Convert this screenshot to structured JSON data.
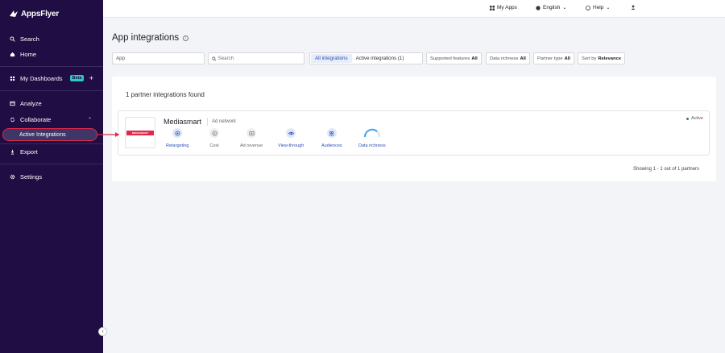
{
  "brand": {
    "name": "AppsFlyer"
  },
  "sidebar": {
    "items": [
      {
        "label": "Search",
        "icon": "search-icon"
      },
      {
        "label": "Home",
        "icon": "home-icon"
      },
      {
        "label": "My Dashboards",
        "icon": "dashboard-icon",
        "badge": "Beta"
      },
      {
        "label": "Analyze",
        "icon": "analyze-icon"
      },
      {
        "label": "Collaborate",
        "icon": "collaborate-icon"
      },
      {
        "label": "Active Integrations"
      },
      {
        "label": "Export",
        "icon": "export-icon"
      },
      {
        "label": "Settings",
        "icon": "gear-icon"
      }
    ]
  },
  "topbar": {
    "my_apps": "My Apps",
    "language": "English",
    "help": "Help"
  },
  "page": {
    "title": "App integrations"
  },
  "filters": {
    "app_value": "App",
    "search_placeholder": "Search",
    "tabs": [
      "All integrations",
      "Active integrations (1)"
    ],
    "supported_features": {
      "label": "Supported features",
      "value": "All"
    },
    "data_richness": {
      "label": "Data richness",
      "value": "All"
    },
    "partner_type": {
      "label": "Partner type",
      "value": "All"
    },
    "sort_by": {
      "label": "Sort by",
      "value": "Relevance"
    }
  },
  "results": {
    "found_text": "1 partner integrations found",
    "showing_text": "Showing 1 - 1 out of 1 partners"
  },
  "partner": {
    "name": "Mediasmart",
    "type": "Ad network",
    "status": "Active",
    "logo_text": "MEDIASMART",
    "features": [
      {
        "label": "Retargeting",
        "enabled": true,
        "icon": "target-icon"
      },
      {
        "label": "Cost",
        "enabled": false,
        "icon": "dollar-icon"
      },
      {
        "label": "Ad revenue",
        "enabled": false,
        "icon": "ad-revenue-icon"
      },
      {
        "label": "View-through",
        "enabled": true,
        "icon": "eye-icon"
      },
      {
        "label": "Audiences",
        "enabled": true,
        "icon": "users-icon"
      },
      {
        "label": "Data richness",
        "enabled": true,
        "icon": "gauge-icon"
      }
    ]
  },
  "colors": {
    "sidebar_bg": "#1f0d43",
    "accent_blue": "#2b4fb3",
    "highlight_red": "#e0284a",
    "beta_badge": "#2ec7c1"
  }
}
